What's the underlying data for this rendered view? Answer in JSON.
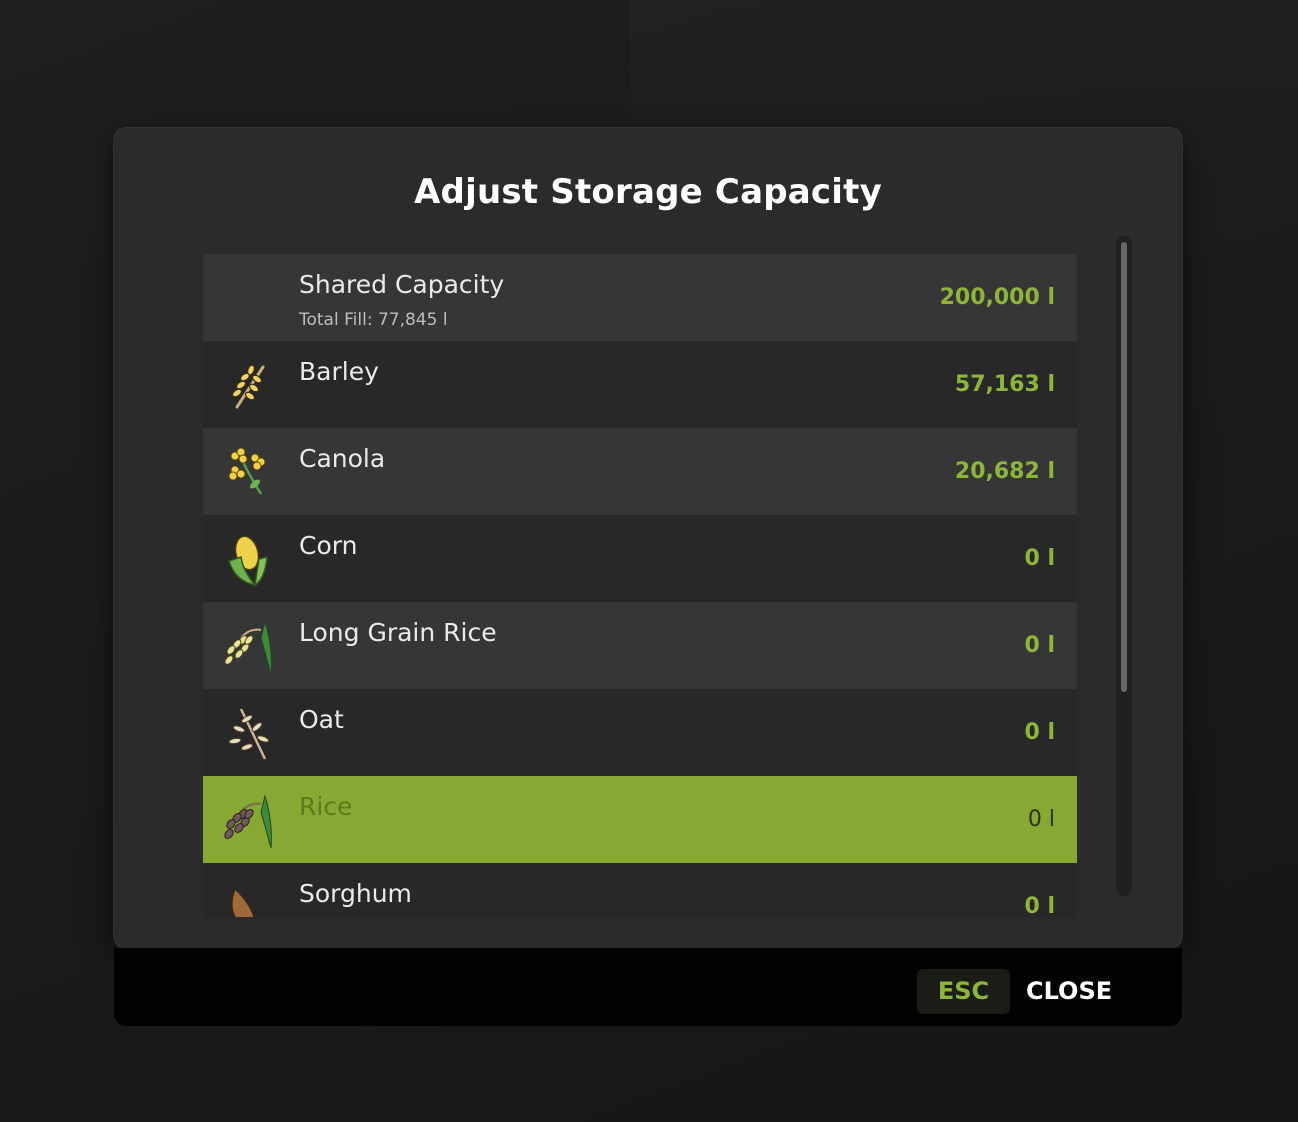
{
  "dialog": {
    "title": "Adjust Storage Capacity"
  },
  "items": [
    {
      "name": "Shared Capacity",
      "sub": "Total Fill: 77,845 l",
      "value": "200,000 l",
      "icon": "none"
    },
    {
      "name": "Barley",
      "value": "57,163 l",
      "icon": "barley-icon"
    },
    {
      "name": "Canola",
      "value": "20,682 l",
      "icon": "canola-icon"
    },
    {
      "name": "Corn",
      "value": "0 l",
      "icon": "corn-icon"
    },
    {
      "name": "Long Grain Rice",
      "value": "0 l",
      "icon": "long-grain-rice-icon"
    },
    {
      "name": "Oat",
      "value": "0 l",
      "icon": "oat-icon"
    },
    {
      "name": "Rice",
      "value": "0 l",
      "icon": "rice-icon",
      "selected": true
    },
    {
      "name": "Sorghum",
      "value": "0 l",
      "icon": "sorghum-icon"
    }
  ],
  "footer": {
    "key_label": "ESC",
    "action_label": "CLOSE"
  },
  "colors": {
    "accent": "#87a832",
    "value_green": "#8db53a"
  }
}
